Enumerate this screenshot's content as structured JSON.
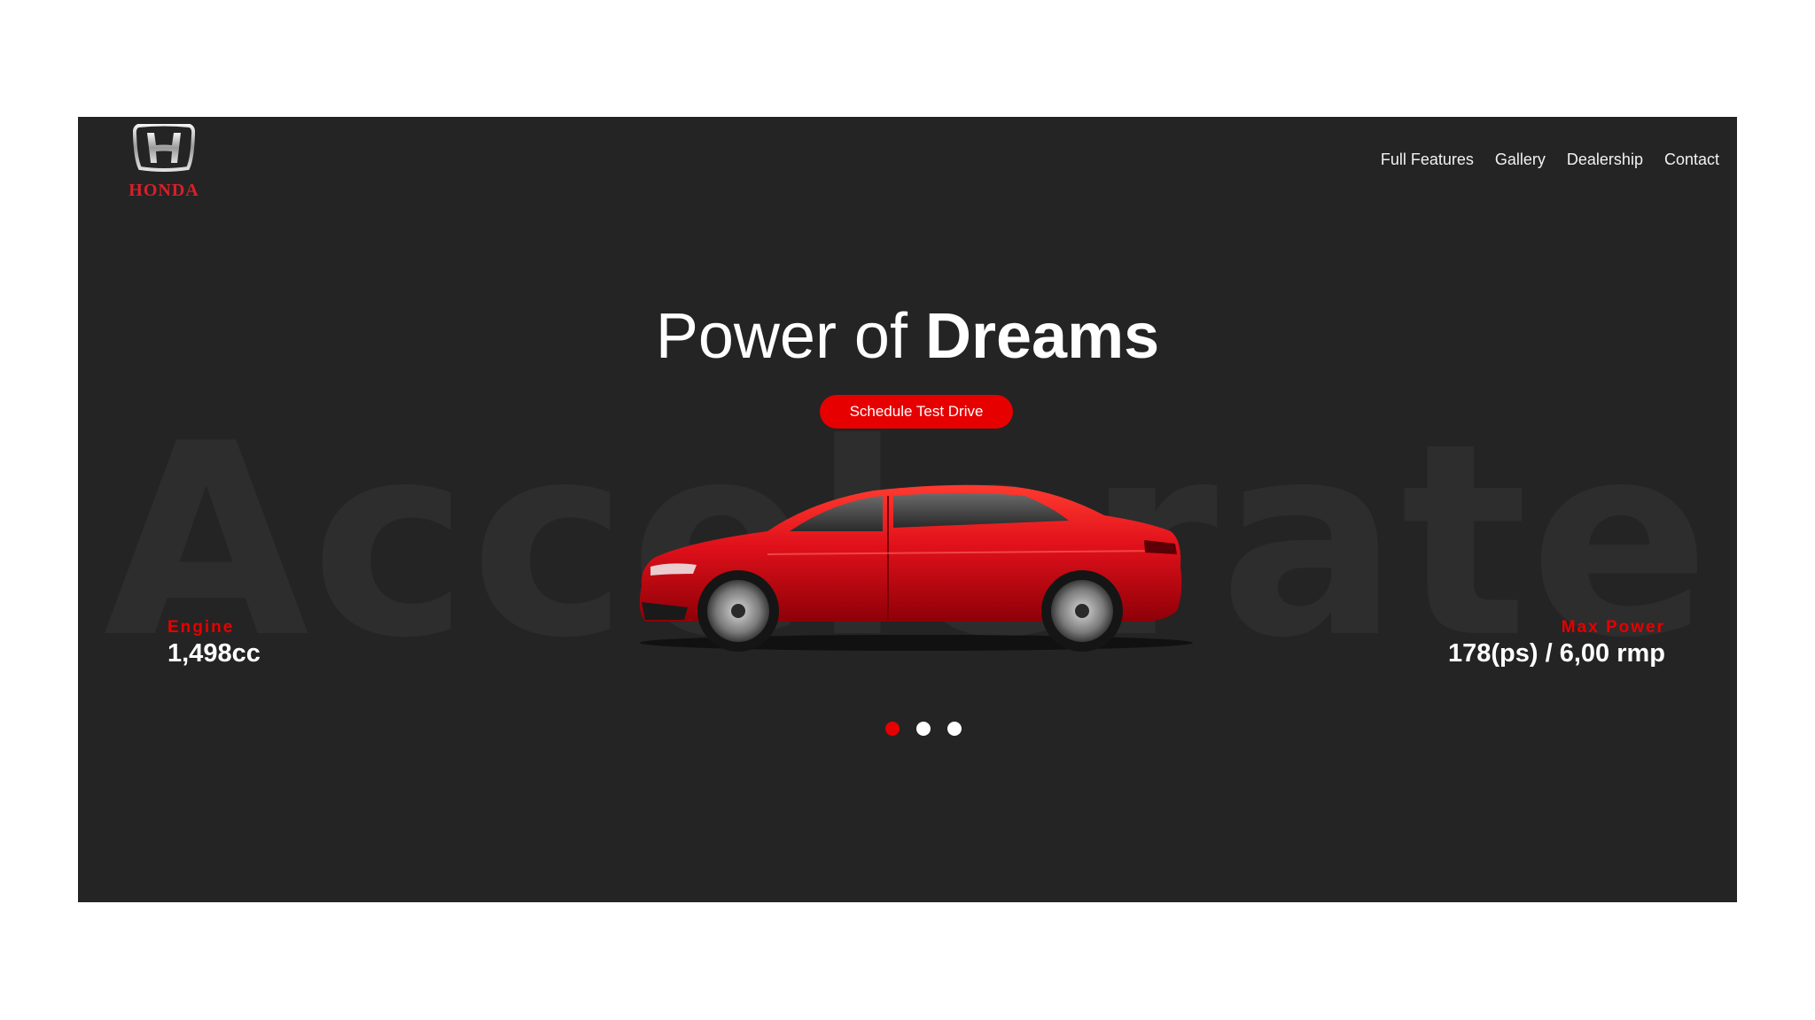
{
  "brand": {
    "name": "HONDA",
    "logo_icon": "honda-h-emblem",
    "color": "#d8202b"
  },
  "nav": {
    "items": [
      {
        "label": "Full Features"
      },
      {
        "label": "Gallery"
      },
      {
        "label": "Dealership"
      },
      {
        "label": "Contact"
      }
    ]
  },
  "hero": {
    "watermark": "Accelerate",
    "title_light": "Power of ",
    "title_bold": "Dreams",
    "cta_label": "Schedule Test Drive",
    "car_image": "red-sedan-side-view"
  },
  "stats": {
    "engine": {
      "label": "Engine",
      "value": "1,498cc"
    },
    "power": {
      "label": "Max Power",
      "value": "178(ps) / 6,00 rmp"
    }
  },
  "carousel": {
    "slide_count": 3,
    "active_index": 0
  },
  "colors": {
    "accent": "#e60000",
    "background": "#242424",
    "text": "#ffffff"
  }
}
